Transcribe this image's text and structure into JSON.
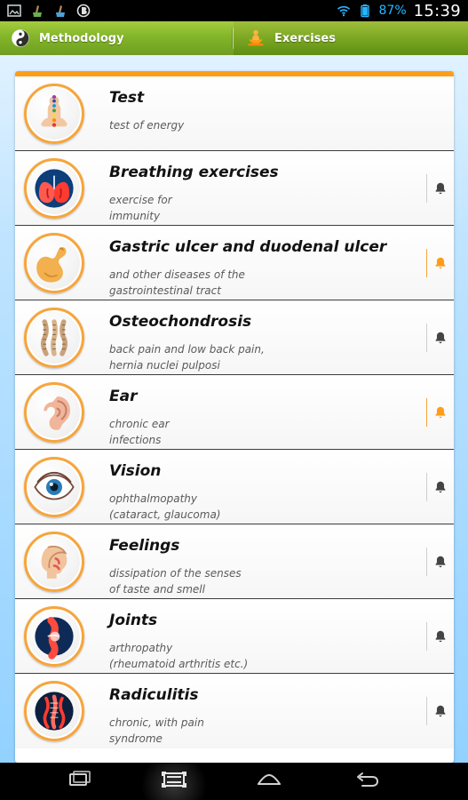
{
  "status_bar": {
    "icons_left": [
      "image-icon",
      "broom-icon",
      "broom-icon",
      "b-logo-icon"
    ],
    "battery_percent": "87%",
    "time": "15:39"
  },
  "tabs": [
    {
      "label": "Methodology",
      "icon": "yin-yang-icon",
      "selected": false
    },
    {
      "label": "Exercises",
      "icon": "meditation-icon",
      "selected": true
    }
  ],
  "list": {
    "accent_color": "#ff9d1a",
    "items": [
      {
        "title": "Test",
        "subtitle_lines": [
          "test of energy"
        ],
        "icon": "chakra-body-icon",
        "bell": null
      },
      {
        "title": "Breathing exercises",
        "subtitle_lines": [
          "exercise for",
          "immunity"
        ],
        "icon": "lungs-icon",
        "bell": "inactive"
      },
      {
        "title": "Gastric ulcer and duodenal ulcer",
        "subtitle_lines": [
          "and other diseases of the",
          "gastrointestinal tract"
        ],
        "icon": "stomach-icon",
        "bell": "active"
      },
      {
        "title": "Osteochondrosis",
        "subtitle_lines": [
          "back pain and low back pain,",
          "hernia nuclei pulposi"
        ],
        "icon": "spine-icon",
        "bell": "inactive"
      },
      {
        "title": "Ear",
        "subtitle_lines": [
          "chronic ear",
          "infections"
        ],
        "icon": "ear-icon",
        "bell": "active"
      },
      {
        "title": "Vision",
        "subtitle_lines": [
          "ophthalmopathy",
          "(cataract, glaucoma)"
        ],
        "icon": "eye-icon",
        "bell": "inactive"
      },
      {
        "title": "Feelings",
        "subtitle_lines": [
          "dissipation of the senses",
          "of taste and smell"
        ],
        "icon": "head-profile-icon",
        "bell": "inactive"
      },
      {
        "title": "Joints",
        "subtitle_lines": [
          "arthropathy",
          "(rheumatoid arthritis etc.)"
        ],
        "icon": "knee-joint-icon",
        "bell": "inactive"
      },
      {
        "title": "Radiculitis",
        "subtitle_lines": [
          "chronic, with pain",
          "syndrome"
        ],
        "icon": "back-spine-icon",
        "bell": "inactive"
      }
    ]
  },
  "colors": {
    "tab_green": "#84b62a",
    "accent_orange": "#f7a53b",
    "bell_inactive": "#444444",
    "bell_active": "#ff9d1a",
    "background_blue": "#8fd0ff"
  },
  "nav_bar": {
    "buttons": [
      "recent-apps-icon",
      "screen-capture-icon",
      "home-icon",
      "back-icon"
    ]
  }
}
